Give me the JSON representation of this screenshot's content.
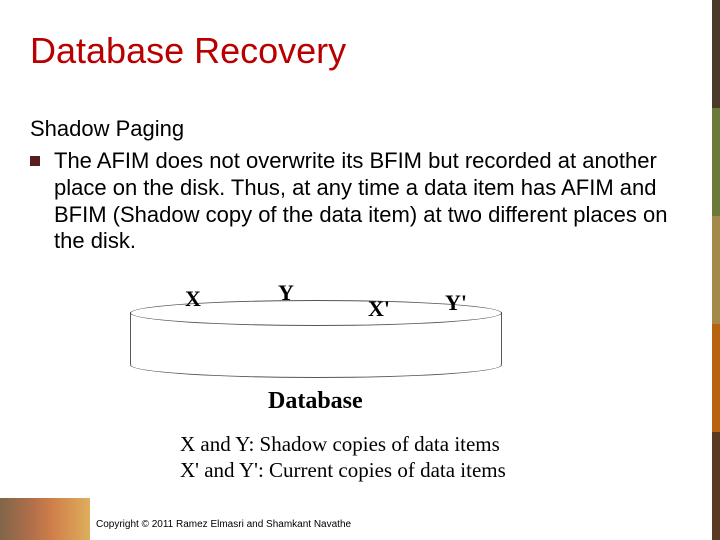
{
  "title": "Database Recovery",
  "subtitle": "Shadow Paging",
  "bullet": "The AFIM does not overwrite its BFIM but recorded at another place on the disk.  Thus, at any time a data item has AFIM and BFIM (Shadow copy of the data item) at two different places on the disk.",
  "diagram": {
    "x": "X",
    "y": "Y",
    "xprime": "X'",
    "yprime": "Y'",
    "db": "Database"
  },
  "caption_line1": "X and Y:  Shadow copies of data items",
  "caption_line2": "X' and Y': Current copies of data items",
  "copyright": "Copyright © 2011 Ramez Elmasri and Shamkant Navathe"
}
